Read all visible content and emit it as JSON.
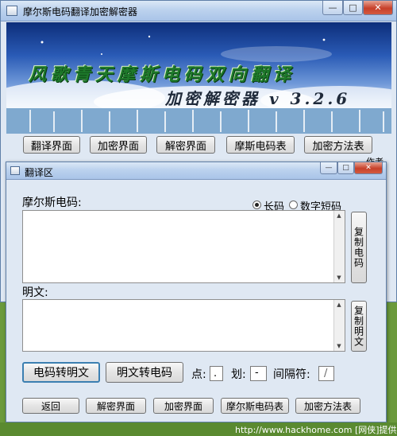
{
  "main_window": {
    "title": "摩尔斯电码翻译加密解密器",
    "banner": {
      "title": "风歌青天摩斯电码双向翻译",
      "subtitle": "加密解密器 v 3.2.6"
    },
    "nav_buttons": [
      "翻译界面",
      "加密界面",
      "解密界面",
      "摩斯电码表",
      "加密方法表"
    ],
    "author_tab": "作者"
  },
  "sub_window": {
    "title": "翻译区",
    "morse_label": "摩尔斯电码:",
    "radio_long": "长码",
    "radio_short": "数字短码",
    "copy_morse": "复制电码",
    "plain_label": "明文:",
    "copy_plain": "复制明文",
    "btn_morse_to_plain": "电码转明文",
    "btn_plain_to_morse": "明文转电码",
    "dot_label": "点:",
    "dot_value": ".",
    "dash_label": "划:",
    "dash_value": "-",
    "sep_label": "间隔符:",
    "sep_value": "/",
    "bottom_buttons": [
      "返回",
      "解密界面",
      "加密界面",
      "摩尔斯电码表",
      "加密方法表"
    ],
    "selected_radio": "长码"
  },
  "footer": {
    "text": "http://www.hackhome.com [网侠]提供"
  }
}
